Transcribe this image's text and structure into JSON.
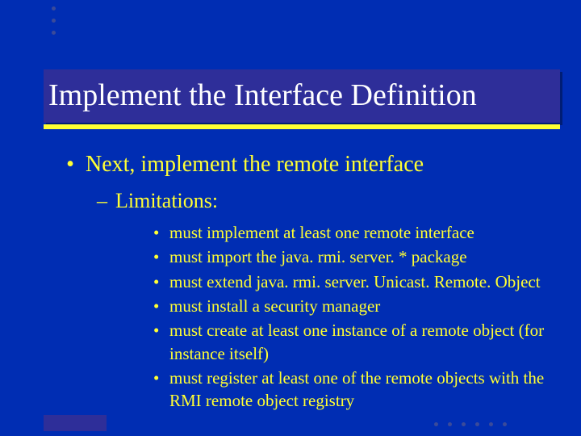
{
  "title": "Implement the Interface Definition",
  "lvl1": "Next, implement the remote interface",
  "lvl2": "Limitations:",
  "bullets": [
    "must implement at least one remote interface",
    "must import the java. rmi. server. * package",
    "must extend java. rmi. server. Unicast. Remote. Object",
    "must install a security manager",
    "must create at least one instance of a remote object (for instance itself)",
    "must register at least one of the remote objects with the RMI remote object registry"
  ]
}
